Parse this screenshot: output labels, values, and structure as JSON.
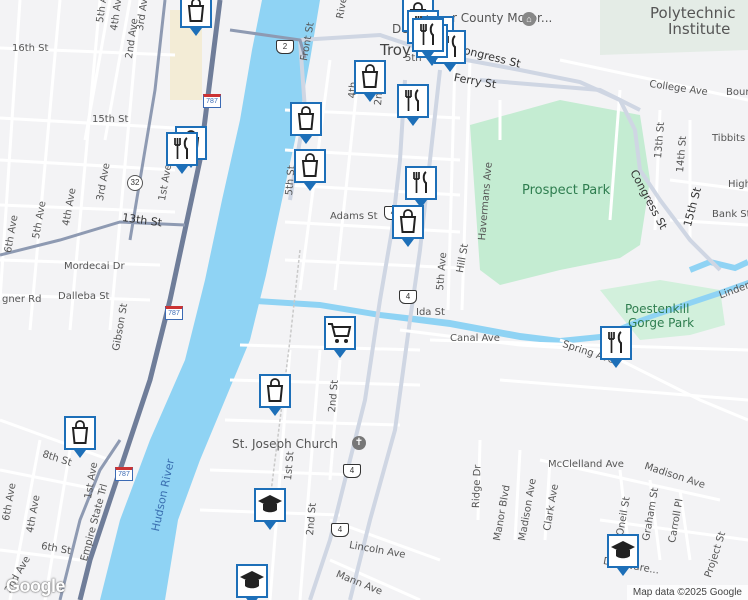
{
  "map": {
    "places": {
      "troy": "Troy",
      "polytechnic_line1": "Polytechnic",
      "polytechnic_line2": "Institute",
      "prospect_park": "Prospect Park",
      "poestenkill_line1": "Poestenkill",
      "poestenkill_line2": "Gorge Park",
      "st_joseph": "St. Joseph Church",
      "hudson_river": "Hudson River",
      "county_motor": "r County Motor...",
      "dep": "Dep"
    },
    "streets": {
      "s16th": "16th St",
      "s15th": "15th St",
      "s13th": "13th St",
      "congress": "Congress St",
      "congress2": "Congress St",
      "ferry": "Ferry St",
      "college": "College Ave",
      "adams": "Adams St",
      "ida": "Ida St",
      "canal": "Canal Ave",
      "spring": "Spring Ave",
      "mordecai": "Mordecai Dr",
      "dalleba": "Dalleba St",
      "gner": "gner Rd",
      "gibson": "Gibson St",
      "mcclelland": "McClelland Ave",
      "madison": "Madison Ave",
      "lincoln": "Lincoln Ave",
      "mann": "Mann Ave",
      "delaware": "Delaware...",
      "s8th": "8th St",
      "s6th": "6th St",
      "empire": "Empire State Trl",
      "front": "Front St",
      "river": "River",
      "ave1": "1st Ave",
      "ave2": "2nd Ave",
      "ave3": "3rd Ave",
      "ave4": "4th Ave",
      "ave5": "5th Ave",
      "ave6": "6th Ave",
      "st1": "1st St",
      "st2": "2nd St",
      "st2b": "2nd St",
      "st2c": "2nd St",
      "st5": "5th",
      "ave5th": "5th Ave",
      "hill": "Hill St",
      "havermans": "Havermans Ave",
      "ridge": "Ridge Dr",
      "manor": "Manor Blvd",
      "madisonave": "Madison Ave",
      "clark": "Clark Ave",
      "oneil": "Oneil St",
      "graham": "Graham St",
      "carroll": "Carroll Pl",
      "project": "Project St",
      "s13thb": "13th St",
      "s14th": "14th St",
      "s15thb": "15th St",
      "tibbits": "Tibbits",
      "bank": "Bank St",
      "hig": "High",
      "linden": "Linden",
      "bour": "Bour",
      "ave2b": "2nd Ave",
      "ave3b": "3rd Ave",
      "ave4b": "4th Ave",
      "ave5b": "5th Ave",
      "ave6b": "6th Ave",
      "st5th": "5th St",
      "st4th": "4th"
    },
    "shields": {
      "r2": "2",
      "r787a": "787",
      "r32": "32",
      "r787b": "787",
      "r787c": "787",
      "r4a": "4",
      "r4b": "4",
      "r4c": "4",
      "r4d": "4"
    },
    "markers": [
      {
        "icon": "shopping-bag-icon"
      },
      {
        "icon": "shopping-bag-icon"
      },
      {
        "icon": "restaurant-icon"
      },
      {
        "icon": "restaurant-icon"
      },
      {
        "icon": "restaurant-icon"
      },
      {
        "icon": "shopping-bag-icon"
      },
      {
        "icon": "restaurant-icon"
      },
      {
        "icon": "shopping-bag-icon"
      },
      {
        "icon": "shopping-bag-icon"
      },
      {
        "icon": "restaurant-icon"
      },
      {
        "icon": "shopping-bag-icon"
      },
      {
        "icon": "shopping-bag-icon"
      },
      {
        "icon": "restaurant-icon"
      },
      {
        "icon": "shopping-bag-icon"
      },
      {
        "icon": "shopping-cart-icon"
      },
      {
        "icon": "restaurant-icon"
      },
      {
        "icon": "shopping-bag-icon"
      },
      {
        "icon": "shopping-bag-icon"
      },
      {
        "icon": "school-icon"
      },
      {
        "icon": "school-icon"
      },
      {
        "icon": "school-icon"
      },
      {
        "icon": "restaurant-icon"
      }
    ],
    "colors": {
      "water": "#8fd3f4",
      "park": "#c4ecd2",
      "marker": "#1d6fb8",
      "highway": "#6f7d99"
    },
    "logo": "Google",
    "attribution": "Map data ©2025 Google"
  }
}
